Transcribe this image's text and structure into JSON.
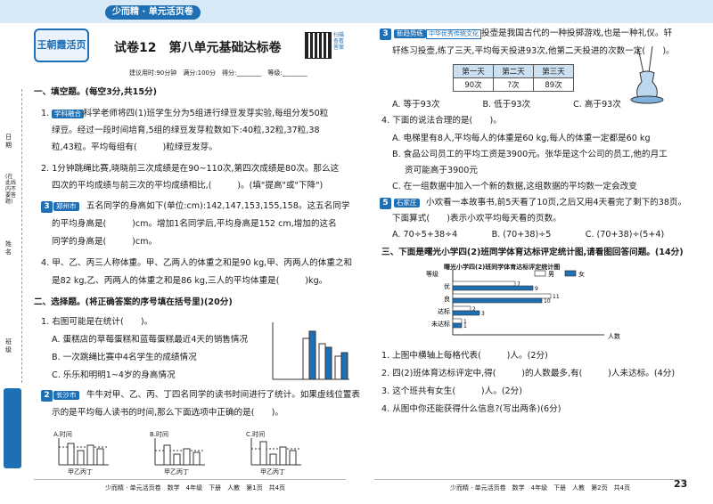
{
  "header": {
    "logo_text": "王朝霞活页",
    "series_title": "少而精 · 单元活页卷",
    "test_title": "试卷12　第八单元基础达标卷",
    "info": "建议用时:90分钟　满分:100分　得分:________　等级:________",
    "qr_label": "扫描查看答案"
  },
  "left_margin": {
    "labels": [
      "日期",
      "(在此线内不要答题)",
      "姓名",
      "班级"
    ]
  },
  "section1": {
    "title": "一、填空题。(每空3分,共15分)",
    "q1_tag": "学科融合",
    "q1_l1": "1.　　　　科学老师将四(1)班学生分为5组进行绿豆发芽实验,每组分发50粒",
    "q1_l2": "绿豆。经过一段时间培育,5组的绿豆发芽粒数如下:40粒,32粒,37粒,38",
    "q1_l3": "粒,43粒。平均每组有(　　　)粒绿豆发芽。",
    "q2_l1": "2. 1分钟跳绳比赛,晓晓前三次成绩是在90~110次,第四次成绩是80次。那么这",
    "q2_l2": "四次的平均成绩与前三次的平均成绩相比,(　　　)。(填\"提高\"或\"下降\")",
    "q3_tag": "郑州市",
    "q3_l1": "五名同学的身高如下(单位:cm):142,147,153,155,158。这五名同学",
    "q3_l2": "的平均身高是(　　　)cm。增加1名同学后,平均身高是152 cm,增加的这名",
    "q3_l3": "同学的身高是(　　　)cm。",
    "q4_l1": "4. 甲、乙、丙三人称体重。甲、乙两人的体重之和是90 kg,甲、丙两人的体重之和",
    "q4_l2": "是82 kg,乙、丙两人的体重之和是86 kg,三人的平均体重是(　　　)kg。"
  },
  "section2": {
    "title": "二、选择题。(将正确答案的序号填在括号里)(20分)",
    "q1": "1. 右图可能是在统计(　　)。",
    "q1_a": "A. 蛋糕店的草莓蛋糕和蓝莓蛋糕最近4天的销售情况",
    "q1_b": "B. 一次跳绳比赛中4名学生的成绩情况",
    "q1_c": "C. 乐乐和明明1~4岁的身高情况",
    "q2_tag": "长沙市",
    "q2_l1": "牛牛对甲、乙、丙、丁四名同学的读书时间进行了统计。如果虚线位置表",
    "q2_l2": "示的是平均每人读书的时间,那么下面选项中正确的是(　　)。",
    "opt_a": "A.",
    "opt_b": "B.",
    "opt_c": "C.",
    "axis_time": "时间",
    "axis_names": "甲乙丙丁"
  },
  "right": {
    "q3_tag": "新趋势练",
    "q3_tag2": "中华优秀传统文化",
    "q3_l1": "投壶是我国古代的一种投掷游戏,也是一种礼仪。轩",
    "q3_l2": "轩练习投壶,练了三天,平均每天投进93次,他第二天投进的次数一定(　　)。",
    "table_headers": [
      "第一天",
      "第二天",
      "第三天"
    ],
    "table_values": [
      "90次",
      "?次",
      "89次"
    ],
    "q3_opts": "A. 等于93次　　　　　B. 低于93次　　　　　C. 高于93次",
    "q4": "4. 下面的说法合理的是(　　)。",
    "q4_a": "A. 电梯里有8人,平均每人的体重是60 kg,每人的体重一定都是60 kg",
    "q4_b1": "B. 食品公司员工的平均工资是3900元。张华是这个公司的员工,他的月工",
    "q4_b2": "资可能高于3900元",
    "q4_c": "C. 在一组数据中加入一个新的数据,这组数据的平均数一定会改变",
    "q5_tag": "石家庄",
    "q5_l1": "小欢看一本故事书,前5天看了10页,之后又用4天看完了剩下的38页。",
    "q5_l2": "下面算式(　　)表示小欢平均每天看的页数。",
    "q5_opts": "A. 70÷5+38÷4　　　　B. (70+38)÷5　　　　C. (70+38)÷(5+4)",
    "s3_title": "三、下面是曙光小学四(2)班同学体育达标评定统计图,请看图回答问题。(14分)",
    "s3_q1": "1. 上图中横轴上每格代表(　　　)人。(2分)",
    "s3_q2": "2. 四(2)班体育达标评定中,得(　　　)的人数最多,有(　　　)人未达标。(4分)",
    "s3_q3": "3. 这个班共有女生(　　　)人。(2分)",
    "s3_q4": "4. 从图中你还能获得什么信息?(写出两条)(6分)"
  },
  "chart_data": {
    "type": "bar",
    "title": "曙光小学四(2)班同学体育达标评定统计图",
    "ylabel": "等级",
    "xlabel": "人数",
    "categories": [
      "优",
      "良",
      "达标",
      "未达标"
    ],
    "series": [
      {
        "name": "男",
        "values": [
          7,
          11,
          2,
          1
        ],
        "color": "#ffffff"
      },
      {
        "name": "女",
        "values": [
          9,
          10,
          3,
          1
        ],
        "color": "#1f6fb5"
      }
    ],
    "xlim": [
      0,
      13
    ],
    "legend": "top"
  },
  "footer": {
    "left": "少而精 · 单元活页卷　数学　4年级　下册　人教　第1页　共4页",
    "right": "少而精 · 单元活页卷　数学　4年级　下册　人教　第2页　共4页",
    "page_number": "23"
  },
  "colors": {
    "brand": "#1f6fb5",
    "header_band": "#d8e9f7"
  }
}
